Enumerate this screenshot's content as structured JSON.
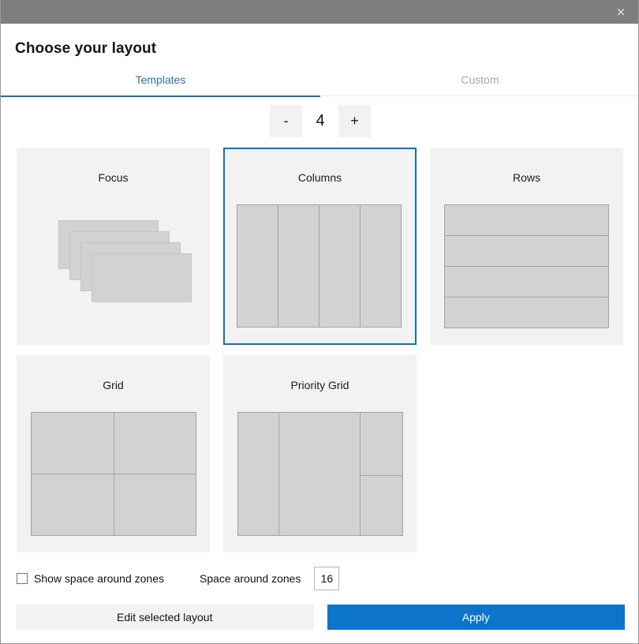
{
  "window": {
    "close_icon": "close-icon",
    "close_glyph": "×",
    "titlebar_color": "#7e7e7e"
  },
  "header": {
    "title": "Choose your layout"
  },
  "tabs": [
    {
      "label": "Templates",
      "active": true
    },
    {
      "label": "Custom",
      "active": false
    }
  ],
  "zone_counter": {
    "decrement_label": "-",
    "value": "4",
    "increment_label": "+"
  },
  "layouts": [
    {
      "name": "Focus",
      "preview": "cascade",
      "zone_count": 4,
      "selected": false
    },
    {
      "name": "Columns",
      "preview": "columns",
      "zone_count": 4,
      "selected": true
    },
    {
      "name": "Rows",
      "preview": "rows",
      "zone_count": 4,
      "selected": false
    },
    {
      "name": "Grid",
      "preview": "grid",
      "zone_count": 4,
      "selected": false
    },
    {
      "name": "Priority Grid",
      "preview": "priority-grid",
      "zone_count": 4,
      "selected": false
    }
  ],
  "options": {
    "show_space_label": "Show space around zones",
    "show_space_checked": false,
    "space_label": "Space around zones",
    "space_value": "16"
  },
  "footer": {
    "edit_label": "Edit selected layout",
    "apply_label": "Apply"
  },
  "colors": {
    "accent": "#0c74cb",
    "selection_border": "#1173b5",
    "tab_active": "#2f6fa8",
    "tab_inactive": "#a6a6a6",
    "card_bg": "#f2f2f2",
    "zone_fill": "#d2d2d2",
    "zone_border": "#a3a3a3",
    "titlebar": "#7e7e7e"
  }
}
